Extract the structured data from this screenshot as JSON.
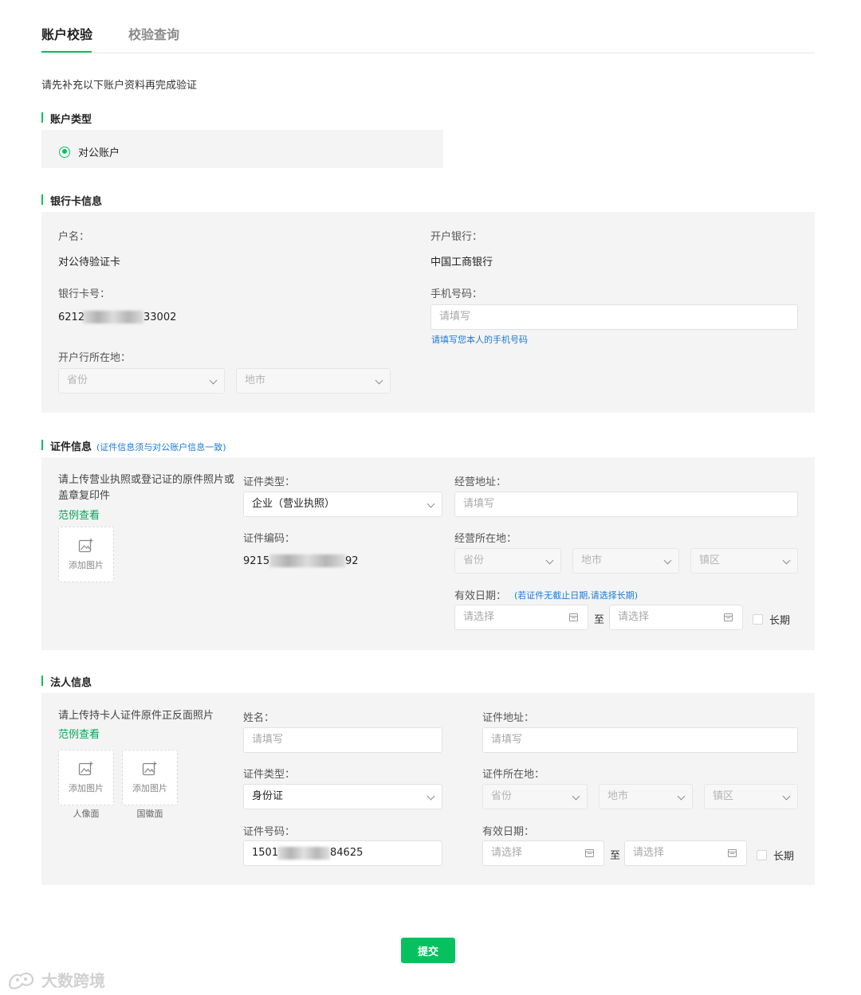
{
  "tabs": [
    {
      "label": "账户校验",
      "active": true
    },
    {
      "label": "校验查询",
      "active": false
    }
  ],
  "intro": "请先补充以下账户资料再完成验证",
  "account_type": {
    "title": "账户类型",
    "option": "对公账户",
    "selected": true
  },
  "bank": {
    "title": "银行卡信息",
    "holder_label": "户名：",
    "holder_value": "对公待验证卡",
    "bank_label": "开户银行：",
    "bank_value": "中国工商银行",
    "card_label": "银行卡号：",
    "card_prefix": "6212",
    "card_suffix": "33002",
    "phone_label": "手机号码：",
    "phone_placeholder": "请填写",
    "phone_hint": "请填写您本人的手机号码",
    "location_label": "开户行所在地：",
    "province_placeholder": "省份",
    "city_placeholder": "地市"
  },
  "cert": {
    "title": "证件信息",
    "note": "(证件信息须与对公账户信息一致)",
    "upload_desc": "请上传营业执照或登记证的原件照片或盖章复印件",
    "example_link": "范例查看",
    "upload_text": "添加图片",
    "type_label": "证件类型：",
    "type_value": "企业（营业执照）",
    "code_label": "证件编码：",
    "code_prefix": "9215",
    "code_suffix": "92",
    "address_label": "经营地址：",
    "address_placeholder": "请填写",
    "location_label": "经营所在地：",
    "province_placeholder": "省份",
    "city_placeholder": "地市",
    "district_placeholder": "镇区",
    "validity_label": "有效日期：",
    "validity_hint": "(若证件无截止日期,请选择长期)",
    "start_placeholder": "请选择",
    "to_text": "至",
    "end_placeholder": "请选择",
    "long_term": "长期"
  },
  "legal": {
    "title": "法人信息",
    "upload_desc": "请上传持卡人证件原件正反面照片",
    "example_link": "范例查看",
    "upload_text": "添加图片",
    "front_caption": "人像面",
    "back_caption": "国徽面",
    "name_label": "姓名：",
    "name_placeholder": "请填写",
    "id_type_label": "证件类型：",
    "id_type_value": "身份证",
    "id_number_label": "证件号码：",
    "id_number_prefix": "1501",
    "id_number_suffix": "84625",
    "address_label": "证件地址：",
    "address_placeholder": "请填写",
    "location_label": "证件所在地：",
    "province_placeholder": "省份",
    "city_placeholder": "地市",
    "district_placeholder": "镇区",
    "validity_label": "有效日期：",
    "start_placeholder": "请选择",
    "to_text": "至",
    "end_placeholder": "请选择",
    "long_term": "长期"
  },
  "submit_label": "提交",
  "watermark": "大数跨境",
  "colors": {
    "accent": "#07c160",
    "link": "#1a7ad9",
    "panel": "#f4f4f4"
  }
}
